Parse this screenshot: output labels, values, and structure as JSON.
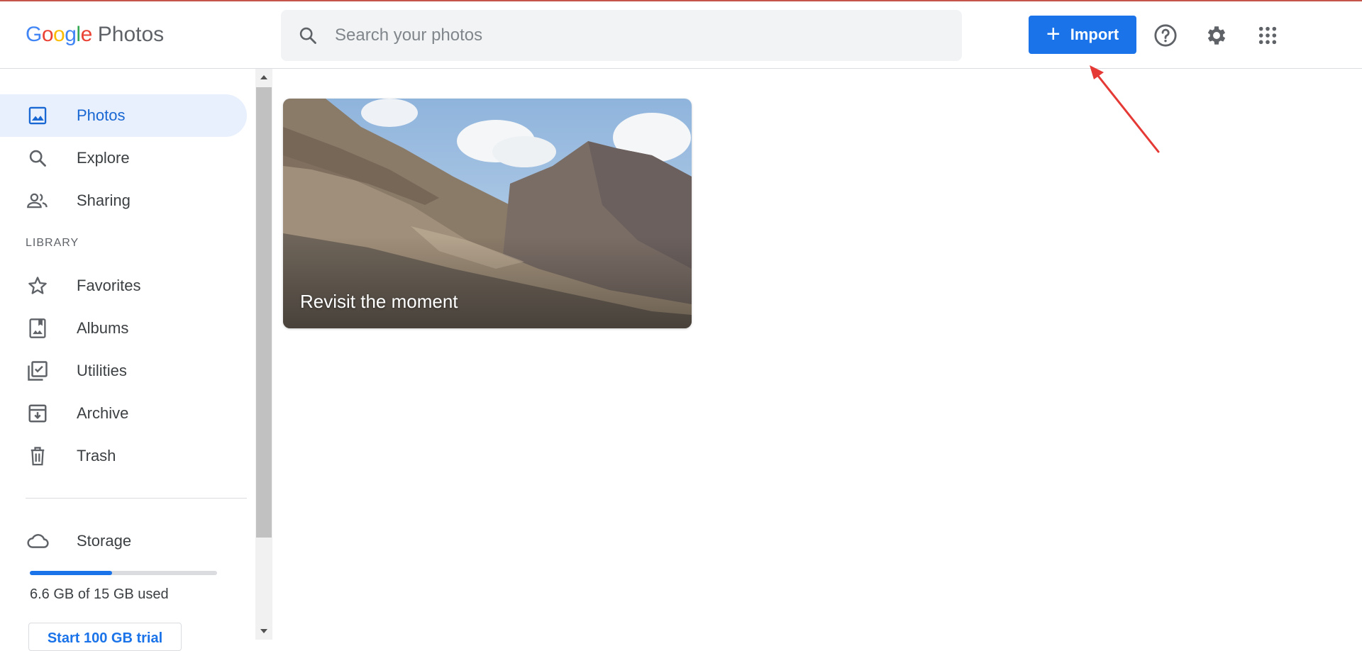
{
  "app": {
    "logo_letters": [
      "G",
      "o",
      "o",
      "g",
      "l",
      "e"
    ],
    "logo_colors": [
      "#4285f4",
      "#ea4335",
      "#fbbc05",
      "#4285f4",
      "#34a853",
      "#ea4335"
    ],
    "product_name": "Photos"
  },
  "search": {
    "placeholder": "Search your photos",
    "icon": "search-icon"
  },
  "header": {
    "import_label": "Import",
    "import_color": "#1a73e8",
    "help_icon": "help-icon",
    "settings_icon": "gear-icon",
    "apps_icon": "apps-grid-icon",
    "annotation_arrow_color": "#e53935"
  },
  "sidebar": {
    "items": [
      {
        "label": "Photos",
        "icon": "photo-icon",
        "active": true
      },
      {
        "label": "Explore",
        "icon": "search-icon"
      },
      {
        "label": "Sharing",
        "icon": "people-icon"
      }
    ],
    "library_heading": "LIBRARY",
    "library_items": [
      {
        "label": "Favorites",
        "icon": "star-icon"
      },
      {
        "label": "Albums",
        "icon": "album-icon"
      },
      {
        "label": "Utilities",
        "icon": "utilities-icon"
      },
      {
        "label": "Archive",
        "icon": "archive-icon"
      },
      {
        "label": "Trash",
        "icon": "trash-icon"
      }
    ],
    "storage": {
      "label": "Storage",
      "icon": "cloud-icon",
      "used_fraction": 0.44,
      "usage_text": "6.6 GB of 15 GB used",
      "trial_button": "Start 100 GB trial"
    }
  },
  "main": {
    "memory_card": {
      "caption": "Revisit the moment"
    }
  },
  "colors": {
    "accent": "#1a73e8",
    "active_bg": "#e8f0fe",
    "active_text": "#1967d2"
  }
}
